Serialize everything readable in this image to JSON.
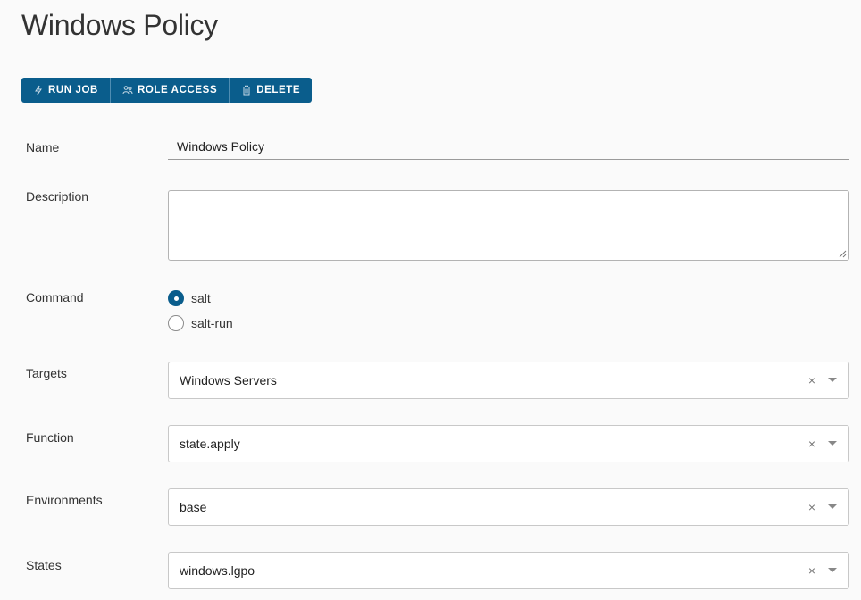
{
  "page": {
    "title": "Windows Policy"
  },
  "toolbar": {
    "run_job_label": "RUN JOB",
    "role_access_label": "ROLE ACCESS",
    "delete_label": "DELETE",
    "button_color": "#0a5d8c"
  },
  "form": {
    "name": {
      "label": "Name",
      "value": "Windows Policy"
    },
    "description": {
      "label": "Description",
      "value": ""
    },
    "command": {
      "label": "Command",
      "options": [
        {
          "label": "salt",
          "checked": true
        },
        {
          "label": "salt-run",
          "checked": false
        }
      ]
    },
    "targets": {
      "label": "Targets",
      "value": "Windows Servers",
      "clear_icon": "×"
    },
    "function": {
      "label": "Function",
      "value": "state.apply",
      "clear_icon": "×"
    },
    "environments": {
      "label": "Environments",
      "value": "base",
      "clear_icon": "×"
    },
    "states": {
      "label": "States",
      "value": "windows.lgpo",
      "clear_icon": "×"
    }
  }
}
